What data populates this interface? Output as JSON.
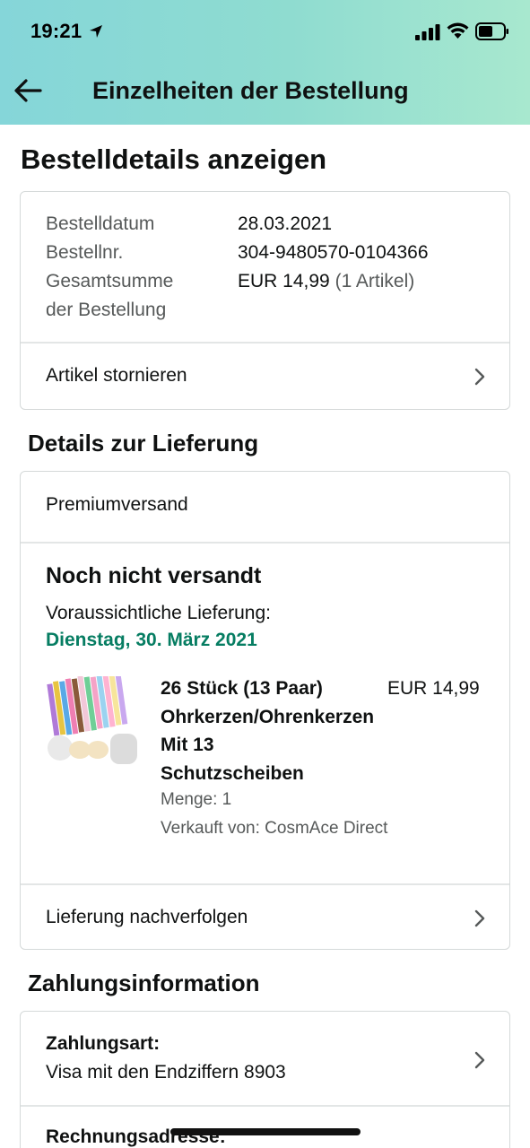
{
  "status_bar": {
    "time": "19:21"
  },
  "nav": {
    "title": "Einzelheiten der Bestellung"
  },
  "page_title": "Bestelldetails anzeigen",
  "order_summary": {
    "date_label": "Bestelldatum",
    "date_value": "28.03.2021",
    "number_label": "Bestellnr.",
    "number_value": "304-9480570-0104366",
    "total_label_line1": "Gesamtsumme",
    "total_label_line2": "der Bestellung",
    "total_value": "EUR 14,99",
    "total_count": "(1 Artikel)",
    "cancel_label": "Artikel stornieren"
  },
  "delivery": {
    "section_title": "Details zur Lieferung",
    "shipping_method": "Premiumversand",
    "status": "Noch nicht versandt",
    "expected_label": "Voraussichtliche Lieferung:",
    "expected_date": "Dienstag, 30. März 2021",
    "item": {
      "title_line1": "26 Stück (13 Paar)",
      "title_line2": "Ohrkerzen/Ohrenkerzen",
      "title_line3": "Mit 13",
      "title_line4": "Schutzscheiben",
      "price": "EUR 14,99",
      "quantity": "Menge: 1",
      "seller": "Verkauft von: CosmAce Direct"
    },
    "track_label": "Lieferung nachverfolgen"
  },
  "payment": {
    "section_title": "Zahlungsinformation",
    "method_label": "Zahlungsart:",
    "method_value": "Visa mit den Endziffern 8903",
    "billing_label": "Rechnungsadresse:"
  },
  "colors": {
    "accent_green": "#067d62",
    "header_gradient_start": "#85d6d9",
    "header_gradient_end": "#a8e8cf"
  }
}
